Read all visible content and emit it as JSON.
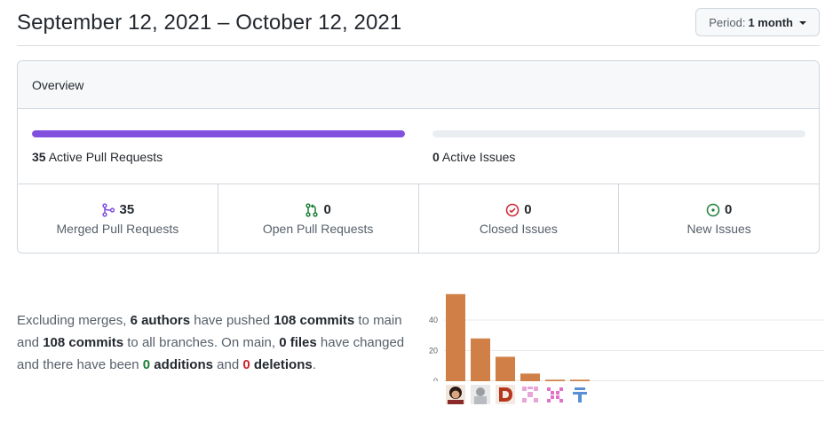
{
  "header": {
    "date_range": "September 12, 2021 – October 12, 2021",
    "period_prefix": "Period:",
    "period_value": "1 month"
  },
  "overview": {
    "title": "Overview",
    "pull_requests": {
      "count": "35",
      "label": "Active Pull Requests",
      "fill_fraction": 1.0,
      "color": "#8250df"
    },
    "issues": {
      "count": "0",
      "label": "Active Issues",
      "fill_fraction": 0.0
    },
    "stats": [
      {
        "count": "35",
        "label": "Merged Pull Requests",
        "icon": "git-merge-icon",
        "color": "#8250df"
      },
      {
        "count": "0",
        "label": "Open Pull Requests",
        "icon": "git-pull-request-icon",
        "color": "#1a7f37"
      },
      {
        "count": "0",
        "label": "Closed Issues",
        "icon": "issue-closed-icon",
        "color": "#cf222e"
      },
      {
        "count": "0",
        "label": "New Issues",
        "icon": "issue-opened-icon",
        "color": "#1a7f37"
      }
    ]
  },
  "summary": {
    "t1": "Excluding merges, ",
    "authors": "6 authors",
    "t2": " have pushed ",
    "commits_main": "108 commits",
    "t3": " to main and ",
    "commits_all": "108 commits",
    "t4": " to all branches. On main, ",
    "files": "0 files",
    "t5": " have changed and there have been ",
    "additions_count": "0",
    "additions_word": " additions",
    "t6": " and ",
    "deletions_count": "0",
    "deletions_word": " deletions",
    "t7": "."
  },
  "chart_data": {
    "type": "bar",
    "categories": [
      "author-1",
      "author-2",
      "author-3",
      "author-4",
      "author-5",
      "author-6"
    ],
    "values": [
      57,
      28,
      16,
      5,
      1,
      1
    ],
    "yticks": [
      0,
      20,
      40
    ],
    "ylim": [
      0,
      58
    ],
    "bar_color": "#d08046",
    "grid": true,
    "title": "",
    "xlabel": "",
    "ylabel": ""
  }
}
